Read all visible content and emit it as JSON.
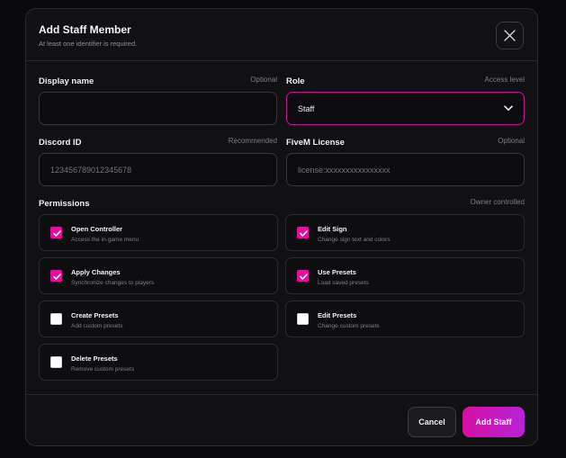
{
  "modal": {
    "title": "Add Staff Member",
    "subtitle": "At least one identifier is required.",
    "close_icon": "close-x-icon"
  },
  "fields": {
    "display_name": {
      "label": "Display name",
      "hint": "Optional",
      "value": "",
      "placeholder": ""
    },
    "role": {
      "label": "Role",
      "hint": "Access level",
      "value": "Staff"
    },
    "discord_id": {
      "label": "Discord ID",
      "hint": "Recommended",
      "value": "",
      "placeholder": "123456789012345678"
    },
    "fivem_license": {
      "label": "FiveM License",
      "hint": "Optional",
      "value": "",
      "placeholder": "license:xxxxxxxxxxxxxxxx"
    }
  },
  "permissions": {
    "label": "Permissions",
    "hint": "Owner controlled",
    "items": [
      {
        "title": "Open Controller",
        "desc": "Access the in-game menu",
        "checked": true
      },
      {
        "title": "Edit Sign",
        "desc": "Change sign text and colors",
        "checked": true
      },
      {
        "title": "Apply Changes",
        "desc": "Synchronize changes to players",
        "checked": true
      },
      {
        "title": "Use Presets",
        "desc": "Load saved presets",
        "checked": true
      },
      {
        "title": "Create Presets",
        "desc": "Add custom presets",
        "checked": false
      },
      {
        "title": "Edit Presets",
        "desc": "Change custom presets",
        "checked": false
      },
      {
        "title": "Delete Presets",
        "desc": "Remove custom presets",
        "checked": false
      }
    ]
  },
  "footer": {
    "cancel_label": "Cancel",
    "submit_label": "Add Staff"
  },
  "colors": {
    "accent": "#e60c9c",
    "accent_gradient_end": "#b623d6",
    "panel": "#111114"
  }
}
